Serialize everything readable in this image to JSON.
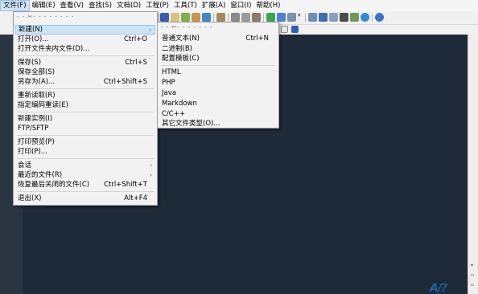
{
  "menubar": [
    "文件(F)",
    "编辑(E)",
    "查看(V)",
    "查找(S)",
    "文档(D)",
    "工程(P)",
    "工具(T)",
    "扩展(A)",
    "窗口(I)",
    "帮助(H)"
  ],
  "file_menu": {
    "tearoff": "- - ✂- - - - - - - -",
    "items": [
      {
        "label": "新建(N)"
      },
      {
        "label": "打开(O)...",
        "shortcut": "Ctrl+O"
      },
      {
        "label": "打开文件夹内文件(D)..."
      },
      {
        "label": "保存(S)",
        "shortcut": "Ctrl+S"
      },
      {
        "label": "保存全部(S)"
      },
      {
        "label": "另存为(A)...",
        "shortcut": "Ctrl+Shift+S"
      },
      {
        "label": "重新读取(R)"
      },
      {
        "label": "指定编码重读(E)"
      },
      {
        "label": "新建实例(I)"
      },
      {
        "label": "FTP/SFTP"
      },
      {
        "label": "打印预览(P)"
      },
      {
        "label": "打印(P)..."
      },
      {
        "label": "会话"
      },
      {
        "label": "最近的文件(R)"
      },
      {
        "label": "恢复最后关闭的文件(C)",
        "shortcut": "Ctrl+Shift+T"
      },
      {
        "label": "退出(X)",
        "shortcut": "Alt+F4"
      }
    ]
  },
  "new_menu": {
    "tearoff": "- - ✂- - - - - - -",
    "items": [
      {
        "label": "普通文本(N)",
        "shortcut": "Ctrl+N"
      },
      {
        "label": "二进制(B)"
      },
      {
        "label": "配置模板(C)"
      },
      {
        "label": "HTML"
      },
      {
        "label": "PHP"
      },
      {
        "label": "Java"
      },
      {
        "label": "Markdown"
      },
      {
        "label": "C/C++"
      },
      {
        "label": "其它文件类型(O)..."
      }
    ]
  },
  "submenu_arrow": "›",
  "watermark": "A/?",
  "icons": [
    "find-icon",
    "edit-icon",
    "cut-icon",
    "copy-icon",
    "share-icon",
    "bars-icon",
    "tool-icon",
    "tool2-icon",
    "tool3-icon",
    "green-icon",
    "blue-icon",
    "wrench-icon",
    "panel-icon",
    "panel2-icon",
    "panel3-icon",
    "monitor-icon",
    "table-icon",
    "browser-icon",
    "help-icon"
  ]
}
